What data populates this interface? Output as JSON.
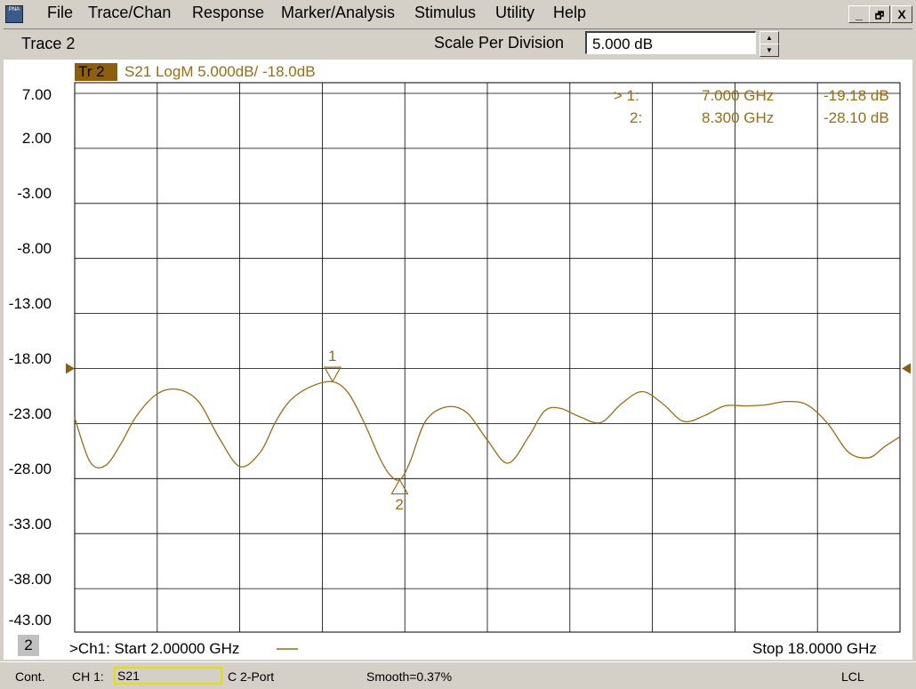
{
  "menubar": {
    "app_icon": "PNA",
    "items": [
      "File",
      "Trace/Chan",
      "Response",
      "Marker/Analysis",
      "Stimulus",
      "Utility",
      "Help"
    ],
    "window_buttons": [
      "_",
      "🗗",
      "X"
    ]
  },
  "toolbar": {
    "trace_label": "Trace 2",
    "scale_label": "Scale Per Division",
    "scale_value": "5.000 dB"
  },
  "trace_header": {
    "badge": "Tr 2",
    "description": "S21 LogM 5.000dB/  -18.0dB"
  },
  "markers": [
    {
      "active": "> 1:",
      "freq": "7.000 GHz",
      "value": "-19.18 dB",
      "label": "1"
    },
    {
      "active": "2:",
      "freq": "8.300 GHz",
      "value": "-28.10 dB",
      "label": "2"
    }
  ],
  "stimulus": {
    "channel_box": "2",
    "start": ">Ch1: Start  2.00000 GHz",
    "stop": "Stop  18.0000 GHz"
  },
  "status": {
    "mode": "Cont.",
    "channel": "CH 1:",
    "measurement": "S21",
    "cal": "C  2-Port",
    "smoothing": "Smooth=0.37%",
    "remote": "LCL"
  },
  "colors": {
    "trace": "#9c6c10",
    "badge": "#8c5f0e",
    "grid": "#000000"
  },
  "chart_data": {
    "type": "line",
    "x_unit": "GHz",
    "y_unit": "dB",
    "xlim": [
      2,
      18
    ],
    "ylim": [
      -43,
      7
    ],
    "reference_level": -18,
    "scale_per_div": 5,
    "y_tick_labels": [
      "7.00",
      "2.00",
      "-3.00",
      "-8.00",
      "-13.00",
      "-18.00",
      "-23.00",
      "-28.00",
      "-33.00",
      "-38.00",
      "-43.00"
    ],
    "grid": true,
    "series": [
      {
        "name": "S21",
        "x": [
          2.0,
          2.3,
          2.6,
          2.9,
          3.2,
          3.6,
          4.0,
          4.4,
          4.8,
          5.2,
          5.6,
          5.9,
          6.2,
          6.6,
          7.0,
          7.3,
          7.6,
          7.9,
          8.1,
          8.3,
          8.5,
          8.8,
          9.2,
          9.6,
          10.0,
          10.4,
          10.8,
          11.1,
          11.4,
          11.8,
          12.2,
          12.6,
          13.0,
          13.4,
          13.8,
          14.2,
          14.6,
          15.0,
          15.4,
          15.8,
          16.2,
          16.6,
          17.0,
          17.4,
          17.7,
          18.0
        ],
        "y": [
          -22.5,
          -26.5,
          -26.8,
          -24.8,
          -22.3,
          -20.3,
          -19.9,
          -21.0,
          -24.3,
          -26.9,
          -25.6,
          -22.8,
          -20.8,
          -19.6,
          -19.2,
          -20.2,
          -22.8,
          -26.0,
          -27.6,
          -28.1,
          -26.5,
          -22.8,
          -21.5,
          -22.0,
          -24.5,
          -26.6,
          -24.2,
          -21.9,
          -21.6,
          -22.4,
          -22.9,
          -21.2,
          -20.1,
          -21.2,
          -22.8,
          -22.3,
          -21.4,
          -21.4,
          -21.3,
          -21.0,
          -21.3,
          -23.0,
          -25.6,
          -26.1,
          -25.1,
          -24.2
        ]
      }
    ]
  }
}
